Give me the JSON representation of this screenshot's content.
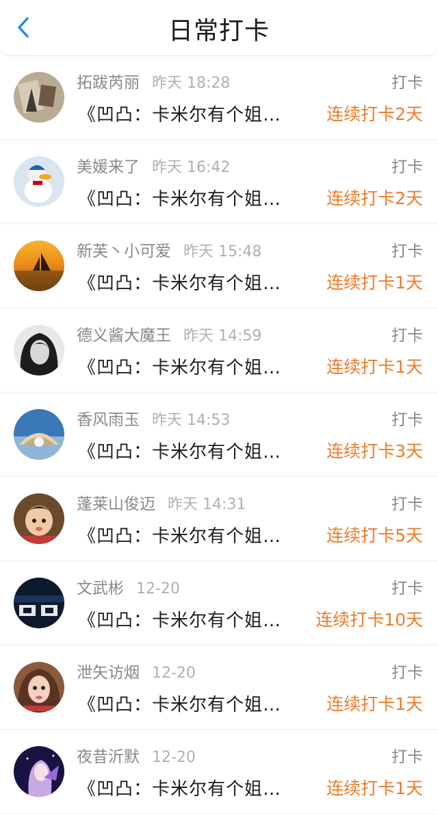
{
  "header": {
    "title": "日常打卡",
    "back_icon": "chevron-left-icon",
    "accent": "#1d8cf0"
  },
  "colors": {
    "streak": "#f07a28",
    "meta": "#888888",
    "time": "#b0b0b0"
  },
  "rows": [
    {
      "name": "拓跋芮丽",
      "time": "昨天 18:28",
      "tag": "打卡",
      "book": "《凹凸：卡米尔有个姐…",
      "streak": "连续打卡2天"
    },
    {
      "name": "美媛来了",
      "time": "昨天 16:42",
      "tag": "打卡",
      "book": "《凹凸：卡米尔有个姐…",
      "streak": "连续打卡2天"
    },
    {
      "name": "新芙丶小可爱",
      "time": "昨天 15:48",
      "tag": "打卡",
      "book": "《凹凸：卡米尔有个姐…",
      "streak": "连续打卡1天"
    },
    {
      "name": "德义酱大魔王",
      "time": "昨天 14:59",
      "tag": "打卡",
      "book": "《凹凸：卡米尔有个姐…",
      "streak": "连续打卡1天"
    },
    {
      "name": "香风雨玉",
      "time": "昨天 14:53",
      "tag": "打卡",
      "book": "《凹凸：卡米尔有个姐…",
      "streak": "连续打卡3天"
    },
    {
      "name": "蓬莱山俊迈",
      "time": "昨天 14:31",
      "tag": "打卡",
      "book": "《凹凸：卡米尔有个姐…",
      "streak": "连续打卡5天"
    },
    {
      "name": "文武彬",
      "time": "12-20",
      "tag": "打卡",
      "book": "《凹凸：卡米尔有个姐…",
      "streak": "连续打卡10天"
    },
    {
      "name": "泄矢访烟",
      "time": "12-20",
      "tag": "打卡",
      "book": "《凹凸：卡米尔有个姐…",
      "streak": "连续打卡1天"
    },
    {
      "name": "夜昔沂默",
      "time": "12-20",
      "tag": "打卡",
      "book": "《凹凸：卡米尔有个姐…",
      "streak": "连续打卡1天"
    }
  ]
}
